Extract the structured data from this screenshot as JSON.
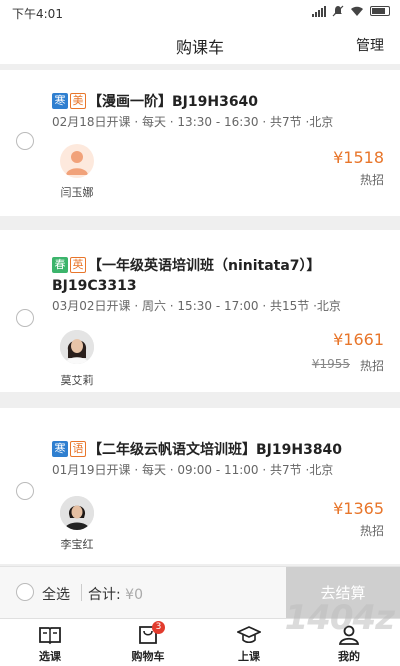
{
  "status_bar": {
    "time": "下午4:01"
  },
  "nav": {
    "title": "购课车",
    "manage_label": "管理"
  },
  "courses": [
    {
      "tags": [
        {
          "text": "寒",
          "style": "blue"
        },
        {
          "text": "美",
          "style": "orange"
        }
      ],
      "title": "【漫画一阶】BJ19H3640",
      "info": "02月18日开课 · 每天 · 13:30 - 16:30 · 共7节 ·北京",
      "teacher": "闫玉娜",
      "price": "¥1518",
      "original_price": "",
      "hot_label": "热招"
    },
    {
      "tags": [
        {
          "text": "春",
          "style": "green"
        },
        {
          "text": "英",
          "style": "orange"
        }
      ],
      "title_line1": "【一年级英语培训班（ninitata7）】",
      "title_line2": "BJ19C3313",
      "info": "03月02日开课 · 周六 · 15:30 - 17:00 · 共15节 ·北京",
      "teacher": "莫艾莉",
      "price": "¥1661",
      "original_price": "¥1955",
      "hot_label": "热招"
    },
    {
      "tags": [
        {
          "text": "寒",
          "style": "blue"
        },
        {
          "text": "语",
          "style": "orange"
        }
      ],
      "title": "【二年级云帆语文培训班】BJ19H3840",
      "info": "01月19日开课 · 每天 · 09:00 - 11:00 · 共7节 ·北京",
      "teacher": "李宝红",
      "price": "¥1365",
      "original_price": "",
      "hot_label": "热招"
    }
  ],
  "checkout": {
    "select_all": "全选",
    "total_label": "合计:",
    "total_value": "¥0",
    "pay_button": "去结算"
  },
  "tabbar": {
    "tabs": [
      {
        "label": "选课",
        "icon": "book-icon"
      },
      {
        "label": "购物车",
        "icon": "cart-icon",
        "badge": "3"
      },
      {
        "label": "上课",
        "icon": "graduation-cap-icon"
      },
      {
        "label": "我的",
        "icon": "person-icon"
      }
    ]
  },
  "watermark": "1404z",
  "colors": {
    "accent": "#e8762b",
    "tag_blue": "#2f7fd0",
    "tag_green": "#3bb46b",
    "badge_red": "#e23b2d"
  }
}
